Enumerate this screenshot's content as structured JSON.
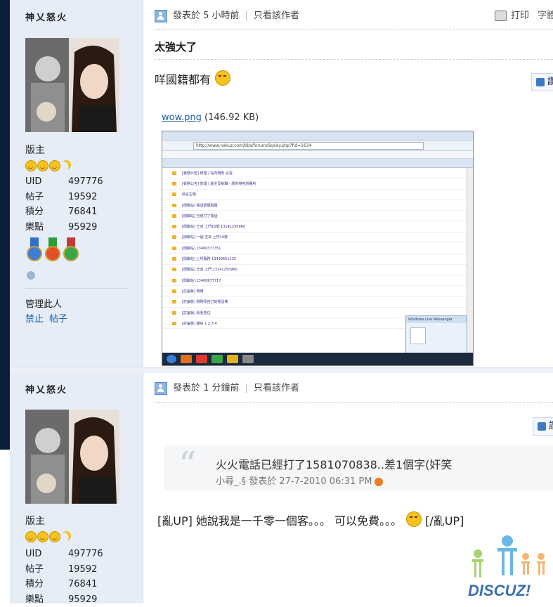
{
  "posts": [
    {
      "author": "神乂怒火",
      "rank": "版主",
      "stats": [
        {
          "key": "UID",
          "value": "497776"
        },
        {
          "key": "帖子",
          "value": "19592"
        },
        {
          "key": "積分",
          "value": "76841"
        },
        {
          "key": "樂點",
          "value": "95929"
        }
      ],
      "manage_label": "管理此人",
      "manage_links": [
        "禁止",
        "帖子"
      ],
      "posted": "發表於  5 小時前",
      "only_author": "只看該作者",
      "print_label": "打印",
      "font_label": "字體",
      "title": "太強大了",
      "body": "咩國籍都有",
      "like_label": "讚",
      "attachment_name": "wow.png",
      "attachment_size": "(146.92 KB)",
      "screenshot": {
        "address": "http://www.nakuz.com/bbs/forumdisplay.php?fid=1634",
        "search": "Google",
        "popup_title": "Windows Live Messenger",
        "rows": [
          "[板務公告] 管理 | 站內規則 必看",
          "[板務公告] 管理 | 版主及板職 - 請你排名的權利",
          "綜合主題",
          "[閒聊站] 電話號碼揭露",
          "[閒聊站] 已經打了電話",
          "[閒聊站] 王京 上門10號 13141250960",
          "[閒聊站] 一個 王京 上門10號",
          "[閒聊站] 13466377351",
          "[閒聊站] 上門服務 13439651125",
          "[閒聊站] 王京 上門 13141250960",
          "[閒聊站] 13488677717",
          "[討論板] 鬧爆",
          "[討論板] 剛剛見自己的電話被",
          "[討論板] 看看各位",
          "[討論板] 靚咗 1 2 3 4"
        ]
      }
    },
    {
      "author": "神乂怒火",
      "rank": "版主",
      "stats": [
        {
          "key": "UID",
          "value": "497776"
        },
        {
          "key": "帖子",
          "value": "19592"
        },
        {
          "key": "積分",
          "value": "76841"
        },
        {
          "key": "樂點",
          "value": "95929"
        }
      ],
      "posted": "發表於  1 分鐘前",
      "only_author": "只看該作者",
      "like_label": "讚",
      "quote_text": "火火電話已經打了1581070838..差1個字(奸笑",
      "quote_meta": "小尋_.§ 發表於 27-7-2010 06:31 PM",
      "body": "[亂UP] 她說我是一千零一個客。。。 可以免費。。。",
      "body_tail": "[/亂UP]"
    }
  ],
  "watermark_text": "DISCUZ!",
  "colors": {
    "sidebar": "#e6edf7",
    "link": "#1a5ea8",
    "left_edge": "#0b1f3a"
  }
}
